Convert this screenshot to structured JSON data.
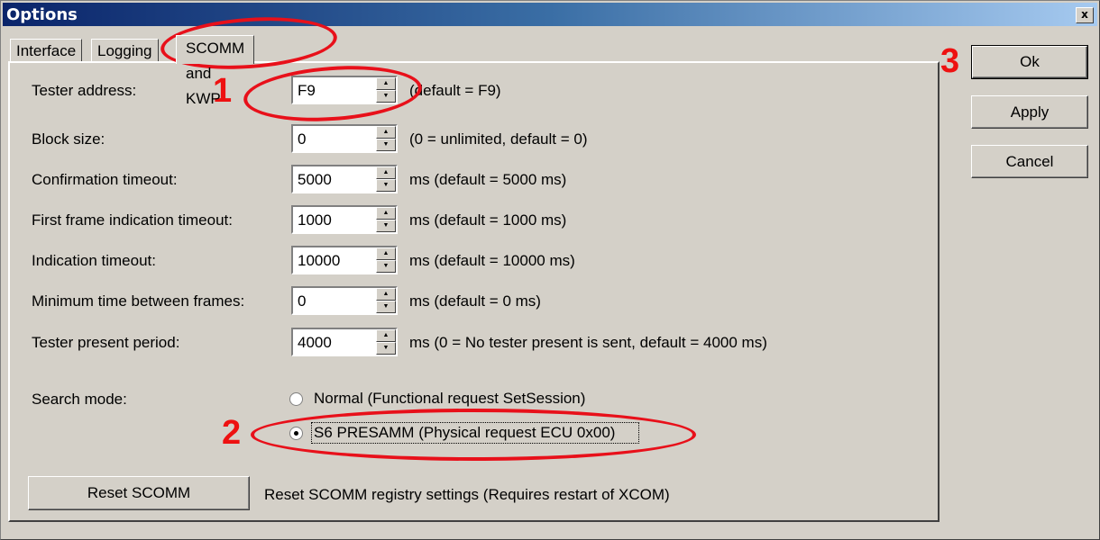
{
  "window": {
    "title": "Options",
    "close_label": "x"
  },
  "tabs": [
    {
      "label": "Interface",
      "active": false
    },
    {
      "label": "Logging",
      "active": false
    },
    {
      "label": "SCOMM and KWP",
      "active": true
    }
  ],
  "fields": [
    {
      "label": "Tester address:",
      "value": "F9",
      "hint": "(default = F9)"
    },
    {
      "label": "Block size:",
      "value": "0",
      "hint": "(0 = unlimited, default = 0)"
    },
    {
      "label": "Confirmation timeout:",
      "value": "5000",
      "hint": "ms (default = 5000 ms)"
    },
    {
      "label": "First frame indication timeout:",
      "value": "1000",
      "hint": "ms (default = 1000 ms)"
    },
    {
      "label": "Indication timeout:",
      "value": "10000",
      "hint": "ms (default = 10000 ms)"
    },
    {
      "label": "Minimum time between frames:",
      "value": "0",
      "hint": "ms (default = 0 ms)"
    },
    {
      "label": "Tester present period:",
      "value": "4000",
      "hint": "ms (0 = No tester present is sent, default = 4000 ms)"
    }
  ],
  "search_mode": {
    "label": "Search mode:",
    "options": [
      {
        "label": "Normal (Functional request SetSession)",
        "selected": false
      },
      {
        "label": "S6 PRESAMM (Physical request ECU 0x00)",
        "selected": true
      }
    ]
  },
  "reset": {
    "button_label": "Reset SCOMM",
    "description": "Reset SCOMM registry settings (Requires restart of XCOM)"
  },
  "buttons": {
    "ok": "Ok",
    "apply": "Apply",
    "cancel": "Cancel"
  },
  "annotations": {
    "one": "1",
    "two": "2",
    "three": "3",
    "color": "#e8101a"
  },
  "icons": {
    "spin_up": "▲",
    "spin_down": "▼"
  }
}
